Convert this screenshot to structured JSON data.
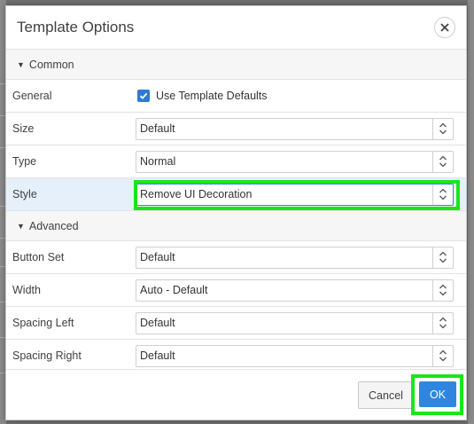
{
  "dialog": {
    "title": "Template Options"
  },
  "sections": {
    "common": {
      "label": "Common"
    },
    "advanced": {
      "label": "Advanced"
    }
  },
  "rows": {
    "general": {
      "label": "General",
      "checkbox_label": "Use Template Defaults",
      "checked": true
    },
    "size": {
      "label": "Size",
      "value": "Default"
    },
    "type": {
      "label": "Type",
      "value": "Normal"
    },
    "style": {
      "label": "Style",
      "value": "Remove UI Decoration"
    },
    "button_set": {
      "label": "Button Set",
      "value": "Default"
    },
    "width": {
      "label": "Width",
      "value": "Auto - Default"
    },
    "spacing_left": {
      "label": "Spacing Left",
      "value": "Default"
    },
    "spacing_right": {
      "label": "Spacing Right",
      "value": "Default"
    }
  },
  "footer": {
    "cancel_label": "Cancel",
    "ok_label": "OK"
  },
  "colors": {
    "accent": "#2f86e0",
    "highlight_row": "#e6f0fa",
    "annotation_green": "#19e619"
  },
  "icons": {
    "close": "close-icon",
    "section_toggle": "triangle-down-icon",
    "select_arrows": "updown-chevron-icon",
    "checkbox": "checkmark-icon"
  }
}
